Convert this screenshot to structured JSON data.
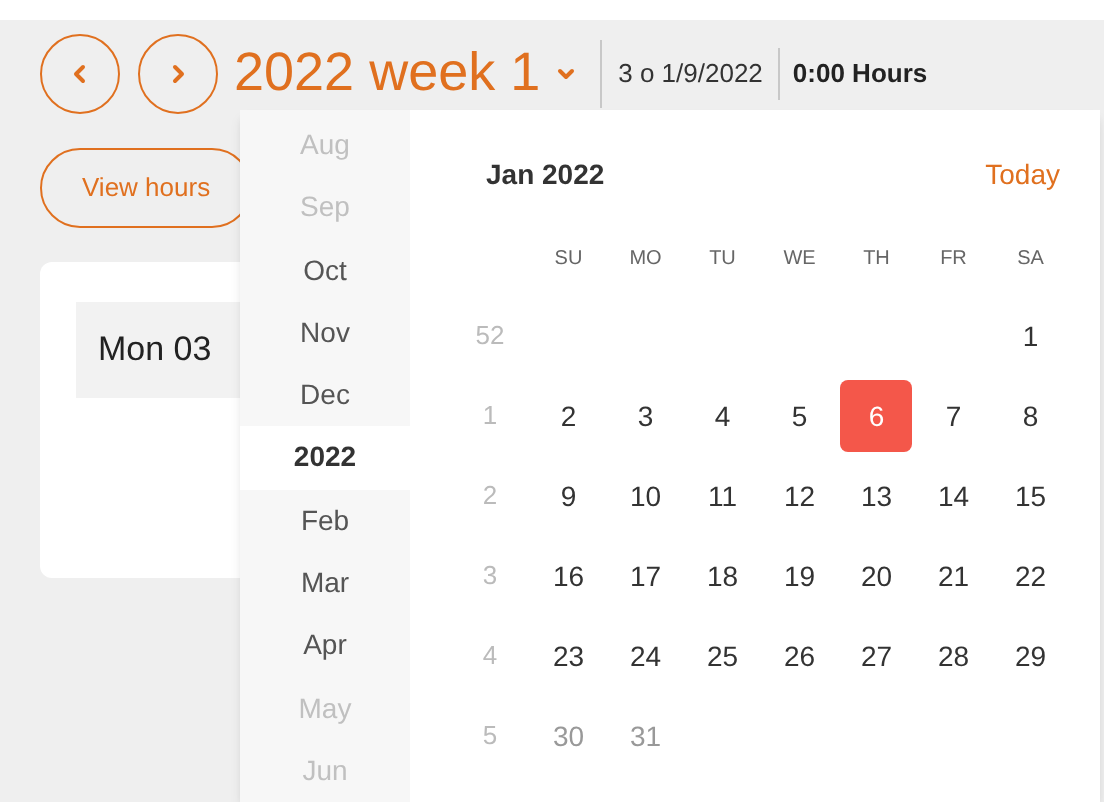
{
  "header": {
    "title": "2022 week 1",
    "range": "3 o 1/9/2022",
    "hours": "0:00 Hours"
  },
  "view_hours_button": "View hours",
  "day_card": {
    "label": "Mon 03"
  },
  "month_list": [
    {
      "label": "Aug",
      "faded": true,
      "selected": false
    },
    {
      "label": "Sep",
      "faded": true,
      "selected": false
    },
    {
      "label": "Oct",
      "faded": false,
      "selected": false
    },
    {
      "label": "Nov",
      "faded": false,
      "selected": false
    },
    {
      "label": "Dec",
      "faded": false,
      "selected": false
    },
    {
      "label": "2022",
      "faded": false,
      "selected": true
    },
    {
      "label": "Feb",
      "faded": false,
      "selected": false
    },
    {
      "label": "Mar",
      "faded": false,
      "selected": false
    },
    {
      "label": "Apr",
      "faded": false,
      "selected": false
    },
    {
      "label": "May",
      "faded": true,
      "selected": false
    },
    {
      "label": "Jun",
      "faded": true,
      "selected": false
    }
  ],
  "calendar": {
    "month": "Jan 2022",
    "today_button": "Today",
    "weekdays": [
      "SU",
      "MO",
      "TU",
      "WE",
      "TH",
      "FR",
      "SA"
    ],
    "weeks": [
      {
        "number": "52",
        "days": [
          {
            "kind": "blank"
          },
          {
            "kind": "blank"
          },
          {
            "kind": "blank"
          },
          {
            "kind": "blank"
          },
          {
            "kind": "blank"
          },
          {
            "kind": "blank"
          },
          {
            "kind": "day",
            "label": "1",
            "selected": false,
            "muted": false
          }
        ]
      },
      {
        "number": "1",
        "days": [
          {
            "kind": "day",
            "label": "2",
            "selected": false,
            "muted": false
          },
          {
            "kind": "day",
            "label": "3",
            "selected": false,
            "muted": false
          },
          {
            "kind": "day",
            "label": "4",
            "selected": false,
            "muted": false
          },
          {
            "kind": "day",
            "label": "5",
            "selected": false,
            "muted": false
          },
          {
            "kind": "day",
            "label": "6",
            "selected": true,
            "muted": false
          },
          {
            "kind": "day",
            "label": "7",
            "selected": false,
            "muted": false
          },
          {
            "kind": "day",
            "label": "8",
            "selected": false,
            "muted": false
          }
        ]
      },
      {
        "number": "2",
        "days": [
          {
            "kind": "day",
            "label": "9",
            "selected": false,
            "muted": false
          },
          {
            "kind": "day",
            "label": "10",
            "selected": false,
            "muted": false
          },
          {
            "kind": "day",
            "label": "11",
            "selected": false,
            "muted": false
          },
          {
            "kind": "day",
            "label": "12",
            "selected": false,
            "muted": false
          },
          {
            "kind": "day",
            "label": "13",
            "selected": false,
            "muted": false
          },
          {
            "kind": "day",
            "label": "14",
            "selected": false,
            "muted": false
          },
          {
            "kind": "day",
            "label": "15",
            "selected": false,
            "muted": false
          }
        ]
      },
      {
        "number": "3",
        "days": [
          {
            "kind": "day",
            "label": "16",
            "selected": false,
            "muted": false
          },
          {
            "kind": "day",
            "label": "17",
            "selected": false,
            "muted": false
          },
          {
            "kind": "day",
            "label": "18",
            "selected": false,
            "muted": false
          },
          {
            "kind": "day",
            "label": "19",
            "selected": false,
            "muted": false
          },
          {
            "kind": "day",
            "label": "20",
            "selected": false,
            "muted": false
          },
          {
            "kind": "day",
            "label": "21",
            "selected": false,
            "muted": false
          },
          {
            "kind": "day",
            "label": "22",
            "selected": false,
            "muted": false
          }
        ]
      },
      {
        "number": "4",
        "days": [
          {
            "kind": "day",
            "label": "23",
            "selected": false,
            "muted": false
          },
          {
            "kind": "day",
            "label": "24",
            "selected": false,
            "muted": false
          },
          {
            "kind": "day",
            "label": "25",
            "selected": false,
            "muted": false
          },
          {
            "kind": "day",
            "label": "26",
            "selected": false,
            "muted": false
          },
          {
            "kind": "day",
            "label": "27",
            "selected": false,
            "muted": false
          },
          {
            "kind": "day",
            "label": "28",
            "selected": false,
            "muted": false
          },
          {
            "kind": "day",
            "label": "29",
            "selected": false,
            "muted": false
          }
        ]
      },
      {
        "number": "5",
        "days": [
          {
            "kind": "day",
            "label": "30",
            "selected": false,
            "muted": true
          },
          {
            "kind": "day",
            "label": "31",
            "selected": false,
            "muted": true
          },
          {
            "kind": "blank"
          },
          {
            "kind": "blank"
          },
          {
            "kind": "blank"
          },
          {
            "kind": "blank"
          },
          {
            "kind": "blank"
          }
        ]
      }
    ]
  }
}
